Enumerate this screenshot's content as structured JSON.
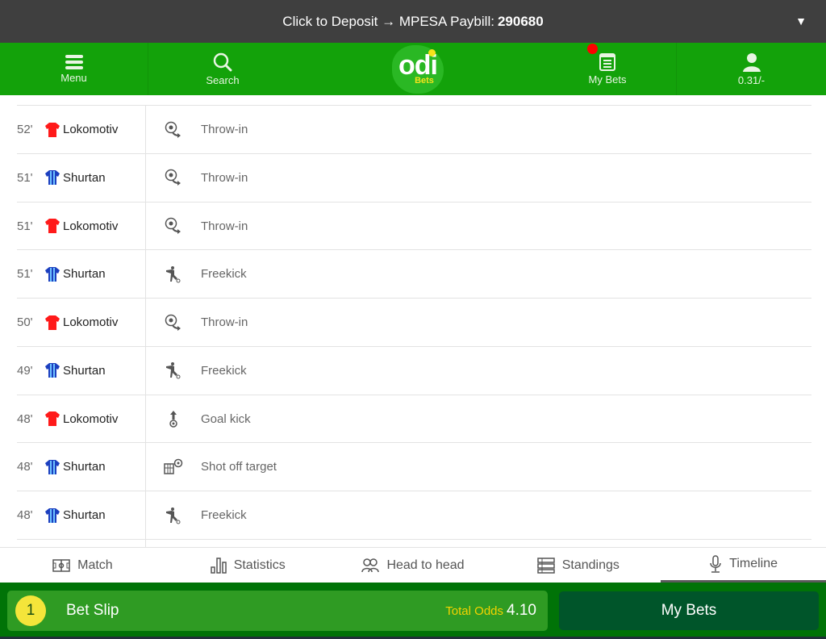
{
  "topbar": {
    "text": "Click to Deposit → MPESA Paybill:",
    "paybill": "290680",
    "caret": "▼"
  },
  "nav": {
    "menu": "Menu",
    "search": "Search",
    "logo": {
      "main": "odi",
      "sub": "Bets"
    },
    "mybets": "My Bets",
    "balance": "0.31/-"
  },
  "timeline": [
    {
      "minute": "52'",
      "team": "Lokomotiv",
      "kit": "red",
      "event": "Throw-in",
      "icon": "throw-in-icon"
    },
    {
      "minute": "51'",
      "team": "Shurtan",
      "kit": "blue",
      "event": "Throw-in",
      "icon": "throw-in-icon"
    },
    {
      "minute": "51'",
      "team": "Lokomotiv",
      "kit": "red",
      "event": "Throw-in",
      "icon": "throw-in-icon"
    },
    {
      "minute": "51'",
      "team": "Shurtan",
      "kit": "blue",
      "event": "Freekick",
      "icon": "freekick-icon"
    },
    {
      "minute": "50'",
      "team": "Lokomotiv",
      "kit": "red",
      "event": "Throw-in",
      "icon": "throw-in-icon"
    },
    {
      "minute": "49'",
      "team": "Shurtan",
      "kit": "blue",
      "event": "Freekick",
      "icon": "freekick-icon"
    },
    {
      "minute": "48'",
      "team": "Lokomotiv",
      "kit": "red",
      "event": "Goal kick",
      "icon": "goal-kick-icon"
    },
    {
      "minute": "48'",
      "team": "Shurtan",
      "kit": "blue",
      "event": "Shot off target",
      "icon": "shot-off-target-icon"
    },
    {
      "minute": "48'",
      "team": "Shurtan",
      "kit": "blue",
      "event": "Freekick",
      "icon": "freekick-icon"
    }
  ],
  "colors": {
    "red_kit": "#ff1a1a",
    "blue_kit": "#1c3fbf",
    "brand_green": "#13a20a"
  },
  "tabs": [
    {
      "label": "Match",
      "active": false
    },
    {
      "label": "Statistics",
      "active": false
    },
    {
      "label": "Head to head",
      "active": false
    },
    {
      "label": "Standings",
      "active": false
    },
    {
      "label": "Timeline",
      "active": true
    }
  ],
  "betslip": {
    "count": "1",
    "label": "Bet Slip",
    "odds_label": "Total Odds",
    "odds_value": "4.10",
    "mybets_label": "My Bets"
  }
}
